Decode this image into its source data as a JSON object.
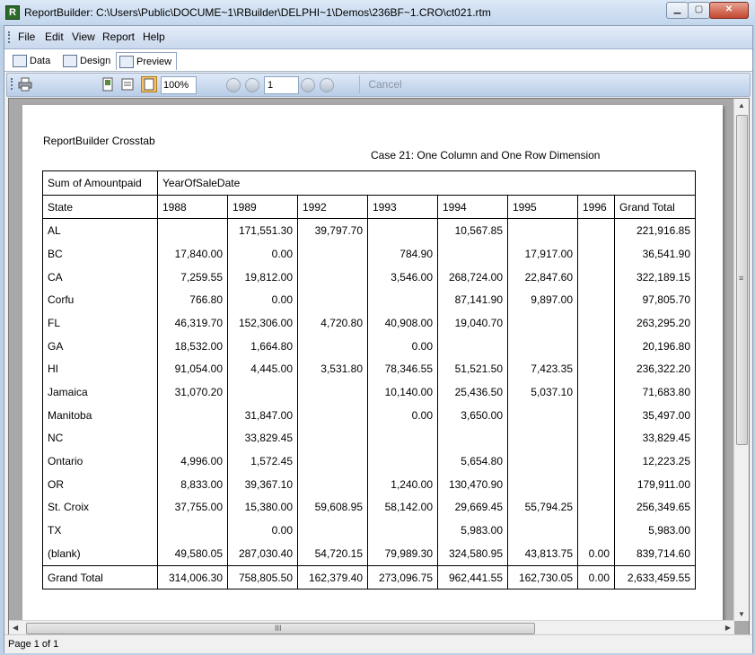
{
  "window": {
    "title": "ReportBuilder: C:\\Users\\Public\\DOCUME~1\\RBuilder\\DELPHI~1\\Demos\\236BF~1.CRO\\ct021.rtm",
    "icon_letter": "R",
    "minimize_label": "▁",
    "maximize_label": "▢",
    "close_label": "✕"
  },
  "menu": {
    "items": [
      "File",
      "Edit",
      "View",
      "Report",
      "Help"
    ]
  },
  "tabs": [
    {
      "label": "Data"
    },
    {
      "label": "Design"
    },
    {
      "label": "Preview",
      "active": true
    }
  ],
  "toolbar": {
    "zoom": "100%",
    "page": "1",
    "cancel_label": "Cancel",
    "icons": [
      "print-icon",
      "whole-page-icon",
      "page-width-icon",
      "zoom-100-icon",
      "first-page-icon",
      "prior-page-icon",
      "next-page-icon",
      "last-page-icon"
    ]
  },
  "report": {
    "title": "ReportBuilder Crosstab",
    "subtitle": "Case 21: One Column and One Row Dimension",
    "value_header": "Sum of Amountpaid",
    "column_dimension": "YearOfSaleDate",
    "row_header": "State",
    "columns": [
      "1988",
      "1989",
      "1992",
      "1993",
      "1994",
      "1995",
      "1996",
      "Grand Total"
    ],
    "rows": [
      [
        "AL",
        "",
        "171,551.30",
        "39,797.70",
        "",
        "10,567.85",
        "",
        "",
        "221,916.85"
      ],
      [
        "BC",
        "17,840.00",
        "0.00",
        "",
        "784.90",
        "",
        "17,917.00",
        "",
        "36,541.90"
      ],
      [
        "CA",
        "7,259.55",
        "19,812.00",
        "",
        "3,546.00",
        "268,724.00",
        "22,847.60",
        "",
        "322,189.15"
      ],
      [
        "Corfu",
        "766.80",
        "0.00",
        "",
        "",
        "87,141.90",
        "9,897.00",
        "",
        "97,805.70"
      ],
      [
        "FL",
        "46,319.70",
        "152,306.00",
        "4,720.80",
        "40,908.00",
        "19,040.70",
        "",
        "",
        "263,295.20"
      ],
      [
        "GA",
        "18,532.00",
        "1,664.80",
        "",
        "0.00",
        "",
        "",
        "",
        "20,196.80"
      ],
      [
        "HI",
        "91,054.00",
        "4,445.00",
        "3,531.80",
        "78,346.55",
        "51,521.50",
        "7,423.35",
        "",
        "236,322.20"
      ],
      [
        "Jamaica",
        "31,070.20",
        "",
        "",
        "10,140.00",
        "25,436.50",
        "5,037.10",
        "",
        "71,683.80"
      ],
      [
        "Manitoba",
        "",
        "31,847.00",
        "",
        "0.00",
        "3,650.00",
        "",
        "",
        "35,497.00"
      ],
      [
        "NC",
        "",
        "33,829.45",
        "",
        "",
        "",
        "",
        "",
        "33,829.45"
      ],
      [
        "Ontario",
        "4,996.00",
        "1,572.45",
        "",
        "",
        "5,654.80",
        "",
        "",
        "12,223.25"
      ],
      [
        "OR",
        "8,833.00",
        "39,367.10",
        "",
        "1,240.00",
        "130,470.90",
        "",
        "",
        "179,911.00"
      ],
      [
        "St. Croix",
        "37,755.00",
        "15,380.00",
        "59,608.95",
        "58,142.00",
        "29,669.45",
        "55,794.25",
        "",
        "256,349.65"
      ],
      [
        "TX",
        "",
        "0.00",
        "",
        "",
        "5,983.00",
        "",
        "",
        "5,983.00"
      ],
      [
        "(blank)",
        "49,580.05",
        "287,030.40",
        "54,720.15",
        "79,989.30",
        "324,580.95",
        "43,813.75",
        "0.00",
        "839,714.60"
      ]
    ],
    "grand_total": [
      "Grand Total",
      "314,006.30",
      "758,805.50",
      "162,379.40",
      "273,096.75",
      "962,441.55",
      "162,730.05",
      "0.00",
      "2,633,459.55"
    ]
  },
  "scrollbar": {
    "h_grip": "III",
    "v_grip": "≡"
  },
  "status": {
    "text": "Page 1 of 1"
  }
}
